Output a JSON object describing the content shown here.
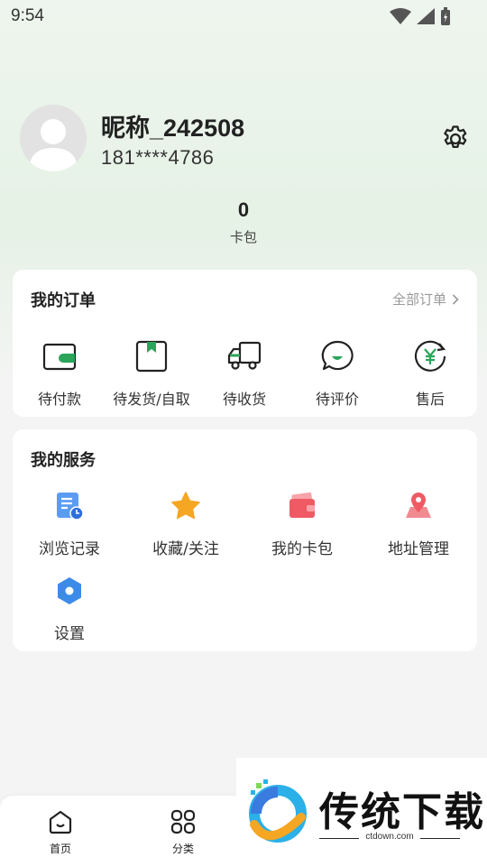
{
  "status_bar": {
    "time": "9:54"
  },
  "profile": {
    "nickname": "昵称_242508",
    "phone": "181****4786"
  },
  "wallet": {
    "count": "0",
    "label": "卡包"
  },
  "orders": {
    "title": "我的订单",
    "all_label": "全部订单",
    "items": [
      {
        "label": "待付款",
        "icon": "wallet-icon"
      },
      {
        "label": "待发货/自取",
        "icon": "bookmark-icon"
      },
      {
        "label": "待收货",
        "icon": "truck-icon"
      },
      {
        "label": "待评价",
        "icon": "comment-icon"
      },
      {
        "label": "售后",
        "icon": "yuan-refresh-icon"
      }
    ]
  },
  "services": {
    "title": "我的服务",
    "items": [
      {
        "label": "浏览记录",
        "icon": "history-icon"
      },
      {
        "label": "收藏/关注",
        "icon": "star-icon"
      },
      {
        "label": "我的卡包",
        "icon": "card-wallet-icon"
      },
      {
        "label": "地址管理",
        "icon": "location-icon"
      },
      {
        "label": "设置",
        "icon": "settings-hexagon-icon"
      }
    ]
  },
  "tabbar": {
    "home": "首页",
    "category": "分类"
  },
  "watermark": {
    "text": "传统下载",
    "url": "ctdown.com"
  },
  "colors": {
    "accent": "#2ba55a",
    "star": "#f5a623",
    "card_red": "#ef5a64",
    "blue": "#3d7be8"
  }
}
